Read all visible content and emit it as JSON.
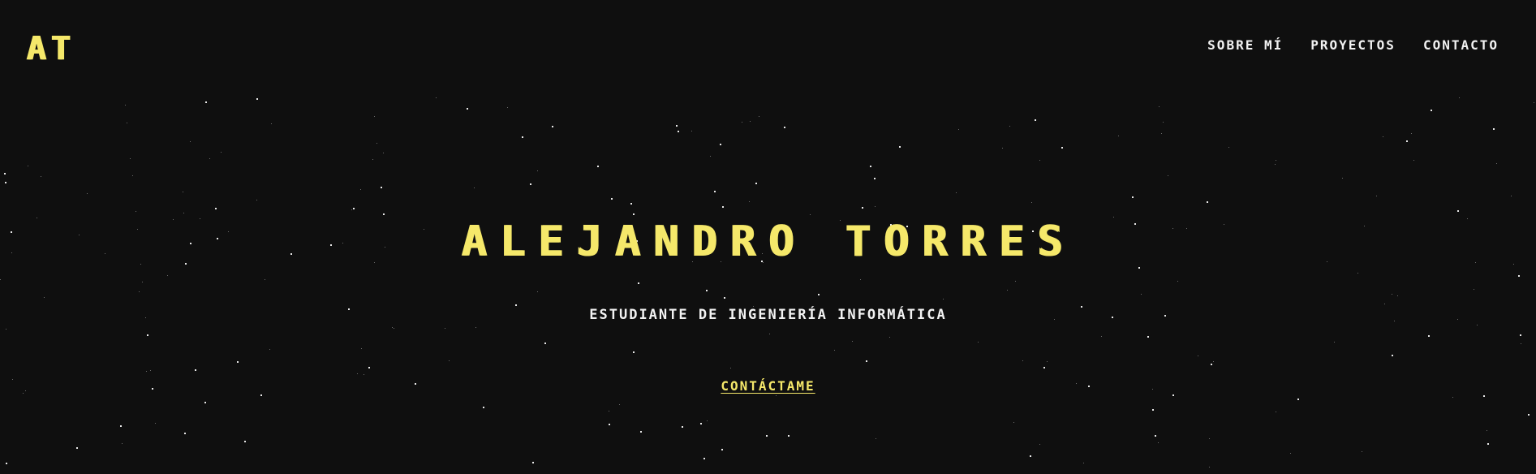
{
  "header": {
    "logo": "AT",
    "nav": [
      {
        "label": "SOBRE MÍ"
      },
      {
        "label": "PROYECTOS"
      },
      {
        "label": "CONTACTO"
      }
    ]
  },
  "hero": {
    "name": "ALEJANDRO TORRES",
    "subtitle": "ESTUDIANTE DE INGENIERÍA INFORMÁTICA",
    "cta_label": "CONTÁCTAME"
  },
  "colors": {
    "background": "#0f0f0f",
    "accent": "#f5e86a",
    "text": "#f2f2f2"
  }
}
